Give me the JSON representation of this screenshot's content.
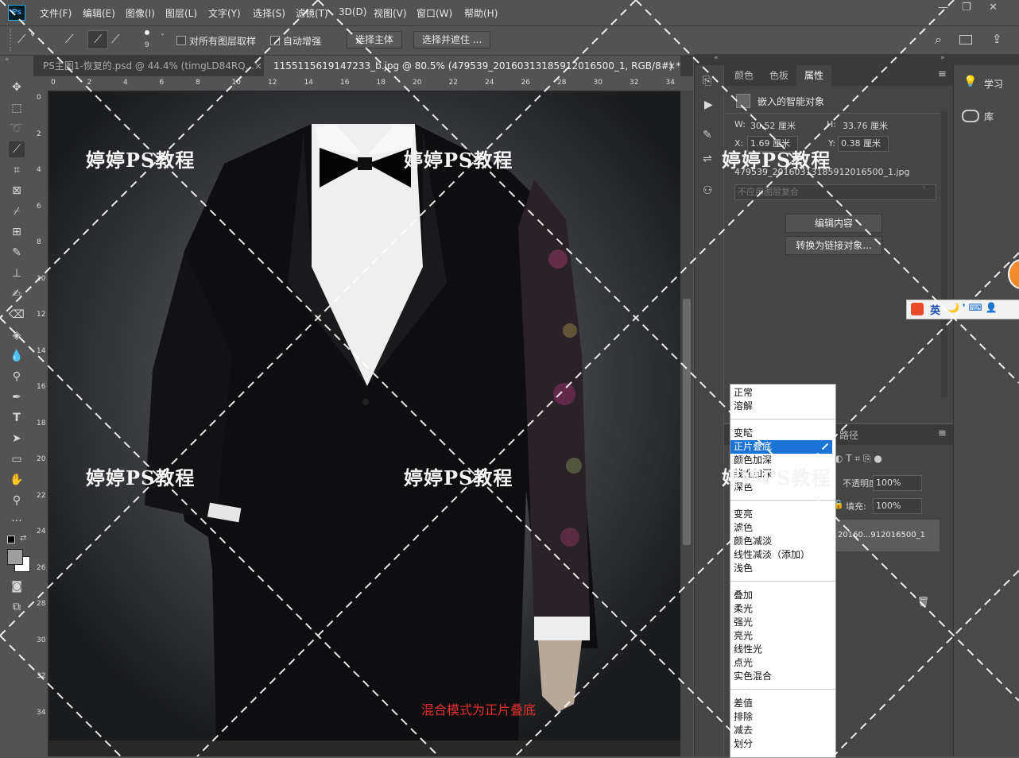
{
  "app": {
    "logo": "Ps"
  },
  "menubar": {
    "items": [
      "文件(F)",
      "编辑(E)",
      "图像(I)",
      "图层(L)",
      "文字(Y)",
      "选择(S)",
      "滤镜(T)",
      "3D(D)",
      "视图(V)",
      "窗口(W)",
      "帮助(H)"
    ],
    "minimize": "—",
    "restore": "❐",
    "close": "✕"
  },
  "options": {
    "brush_size": "9",
    "sample_all_label": "对所有图层取样",
    "auto_enhance_label": "自动增强",
    "select_subject": "选择主体",
    "select_mask": "选择并遮住 ..."
  },
  "tabs": [
    {
      "label": "PS主图1-恢复的.psd @ 44.4% (timgLD84RQ...",
      "close": "×"
    },
    {
      "label": "1155115619147233_b.jpg @ 80.5% (479539_20160313185912016500_1, RGB/8#) *",
      "close": "×"
    }
  ],
  "ruler": {
    "top": [
      "0",
      "2",
      "4",
      "6",
      "8",
      "10",
      "12",
      "14",
      "16",
      "18",
      "20",
      "22",
      "24",
      "26",
      "28",
      "30",
      "32",
      "34"
    ],
    "left": [
      "0",
      "2",
      "4",
      "6",
      "8",
      "10",
      "12",
      "14",
      "16",
      "18",
      "20",
      "22",
      "24",
      "26",
      "28",
      "30",
      "32",
      "34"
    ]
  },
  "canvas": {
    "watermark": "婷婷PS教程",
    "caption": "混合模式为正片叠底"
  },
  "properties": {
    "tabs": [
      "颜色",
      "色板",
      "属性"
    ],
    "type_label": "嵌入的智能对象",
    "w_label": "W:",
    "w_value": "30.52 厘米",
    "h_label": "H:",
    "h_value": "33.76 厘米",
    "x_label": "X:",
    "x_value": "1.69 厘米",
    "y_label": "Y:",
    "y_value": "0.38 厘米",
    "filename": "479539_20160313185912016500_1.jpg",
    "comp_select": "不应用图层复合",
    "edit_button": "编辑内容",
    "convert_button": "转换为链接对象..."
  },
  "layers": {
    "tab_paths": "路径",
    "opacity_label": "不透明度:",
    "opacity_value": "100%",
    "fill_label": "填充:",
    "fill_value": "100%",
    "layer_name": "20160...912016500_1"
  },
  "right_panel": {
    "learn": "学习",
    "library": "库"
  },
  "blend_modes": {
    "groups": [
      [
        "正常",
        "溶解"
      ],
      [
        "变暗",
        "正片叠底",
        "颜色加深",
        "线性加深",
        "深色"
      ],
      [
        "变亮",
        "滤色",
        "颜色减淡",
        "线性减淡（添加）",
        "浅色"
      ],
      [
        "叠加",
        "柔光",
        "强光",
        "亮光",
        "线性光",
        "点光",
        "实色混合"
      ],
      [
        "差值",
        "排除",
        "减去",
        "划分"
      ]
    ],
    "selected": "正片叠底"
  },
  "ime": {
    "label": "英"
  },
  "colors": {
    "accent": "#1a74d6",
    "caption": "#e53030",
    "ps_blue": "#31a8ff"
  }
}
